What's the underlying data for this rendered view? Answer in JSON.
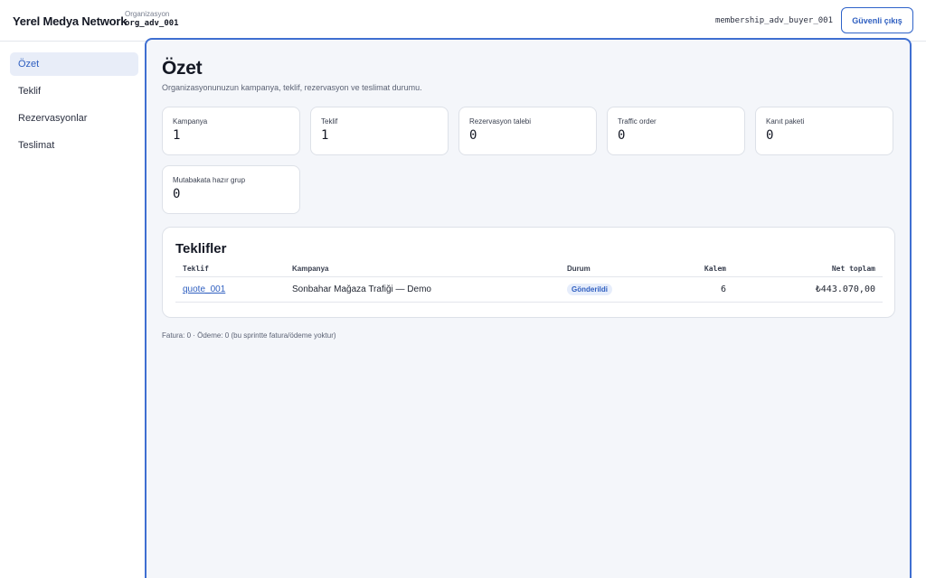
{
  "header": {
    "brand": "Yerel Medya Network",
    "org_label": "Organizasyon",
    "org_value": "org_adv_001",
    "membership": "membership_adv_buyer_001",
    "logout_label": "Güvenli çıkış"
  },
  "sidebar": {
    "items": [
      {
        "label": "Özet",
        "active": true
      },
      {
        "label": "Teklif"
      },
      {
        "label": "Rezervasyonlar"
      },
      {
        "label": "Teslimat"
      }
    ]
  },
  "main": {
    "title": "Özet",
    "subtitle": "Organizasyonunuzun kampanya, teklif, rezervasyon ve teslimat durumu.",
    "stats": [
      {
        "label": "Kampanya",
        "value": "1"
      },
      {
        "label": "Teklif",
        "value": "1"
      },
      {
        "label": "Rezervasyon talebi",
        "value": "0"
      },
      {
        "label": "Traffic order",
        "value": "0"
      },
      {
        "label": "Kanıt paketi",
        "value": "0"
      },
      {
        "label": "Mutabakata hazır grup",
        "value": "0"
      }
    ],
    "quotes": {
      "title": "Teklifler",
      "columns": {
        "quote": "Teklif",
        "campaign": "Kampanya",
        "status": "Durum",
        "items": "Kalem",
        "net_total": "Net toplam"
      },
      "rows": [
        {
          "quote": "quote_001",
          "campaign": "Sonbahar Mağaza Trafiği — Demo",
          "status": "Gönderildi",
          "items": "6",
          "net_total": "₺443.070,00"
        }
      ]
    },
    "footnote": "Fatura: 0 · Ödeme: 0 (bu sprintte fatura/ödeme yoktur)"
  },
  "colors": {
    "accent": "#2f5fc0",
    "panel_border": "#3f6fd1",
    "panel_bg": "#f4f6fa",
    "badge_bg": "#e6edfb"
  }
}
